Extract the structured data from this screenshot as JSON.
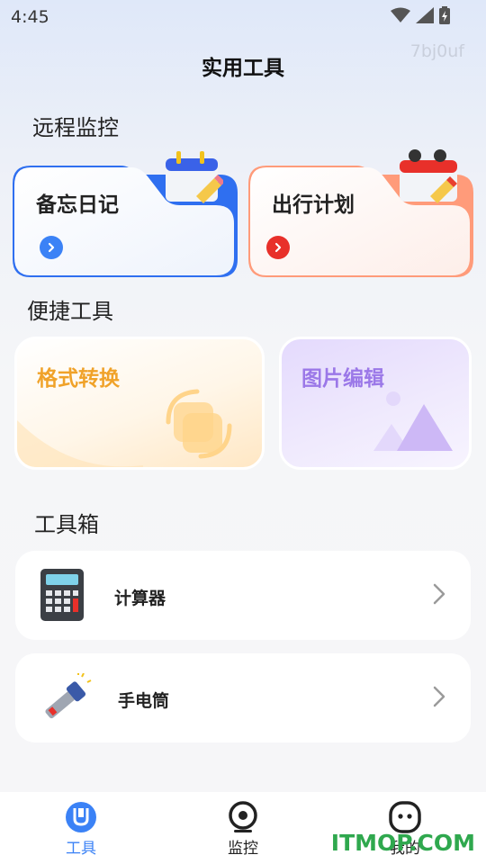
{
  "status_bar": {
    "time": "4:45"
  },
  "header": {
    "title": "实用工具",
    "code": "7bj0uf"
  },
  "remote": {
    "section_title": "远程监控",
    "cards": [
      {
        "label": "备忘日记",
        "accent": "#2f7de8"
      },
      {
        "label": "出行计划",
        "accent": "#e8402f"
      }
    ]
  },
  "quick": {
    "section_title": "便捷工具",
    "cards": [
      {
        "label": "格式转换",
        "color": "#f0a229"
      },
      {
        "label": "图片编辑",
        "color": "#9b78e8"
      }
    ]
  },
  "toolbox": {
    "section_title": "工具箱",
    "items": [
      {
        "label": "计算器",
        "icon": "calculator-icon"
      },
      {
        "label": "手电筒",
        "icon": "flashlight-icon"
      }
    ]
  },
  "nav": {
    "items": [
      {
        "label": "工具",
        "icon": "toolbox-icon",
        "active": true
      },
      {
        "label": "监控",
        "icon": "camera-icon",
        "active": false
      },
      {
        "label": "我的",
        "icon": "robot-face-icon",
        "active": false
      }
    ],
    "active_color": "#3b82f6"
  },
  "watermark": {
    "text": "ITMOP.COM"
  }
}
